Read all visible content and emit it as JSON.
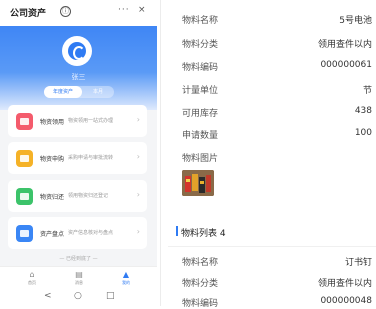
{
  "phone": {
    "title": "公司资产",
    "info_icon": "ⓘ",
    "more_icon": "···",
    "close_icon": "×",
    "user_name": "张三",
    "tabs": [
      "年度资产",
      "本月"
    ],
    "cards": [
      {
        "title": "物资领用",
        "desc": "物资领用一站式办理",
        "icon": "clipboard-icon",
        "color": "#f45b6c"
      },
      {
        "title": "物资申购",
        "desc": "采购申请与审批流转",
        "icon": "cart-icon",
        "color": "#f5b227"
      },
      {
        "title": "物资归还",
        "desc": "领用物资归还登记",
        "icon": "return-icon",
        "color": "#3cc36a"
      },
      {
        "title": "资产盘点",
        "desc": "资产信息核对与盘点",
        "icon": "scan-icon",
        "color": "#3a86f5"
      }
    ],
    "footer_note": "— 已经到底了 —",
    "nav": [
      {
        "label": "首页",
        "icon": "home-icon"
      },
      {
        "label": "消息",
        "icon": "message-icon"
      },
      {
        "label": "我的",
        "icon": "user-icon"
      }
    ],
    "android_buttons": [
      "<",
      "○",
      "□"
    ]
  },
  "detail": {
    "rows": [
      {
        "label": "物料名称",
        "value": "5号电池"
      },
      {
        "label": "物料分类",
        "value": "领用查件以内"
      },
      {
        "label": "物料编码",
        "value": "000000061"
      },
      {
        "label": "计量单位",
        "value": "节"
      },
      {
        "label": "可用库存",
        "value": "438"
      },
      {
        "label": "申请数量",
        "value": "100"
      }
    ],
    "image_label": "物料图片",
    "section_title": "物料列表 4",
    "rows2": [
      {
        "label": "物料名称",
        "value": "订书钉"
      },
      {
        "label": "物料分类",
        "value": "领用查件以内"
      },
      {
        "label": "物料编码",
        "value": "000000048"
      }
    ]
  },
  "colors": {
    "accent": "#2f7bf3"
  }
}
